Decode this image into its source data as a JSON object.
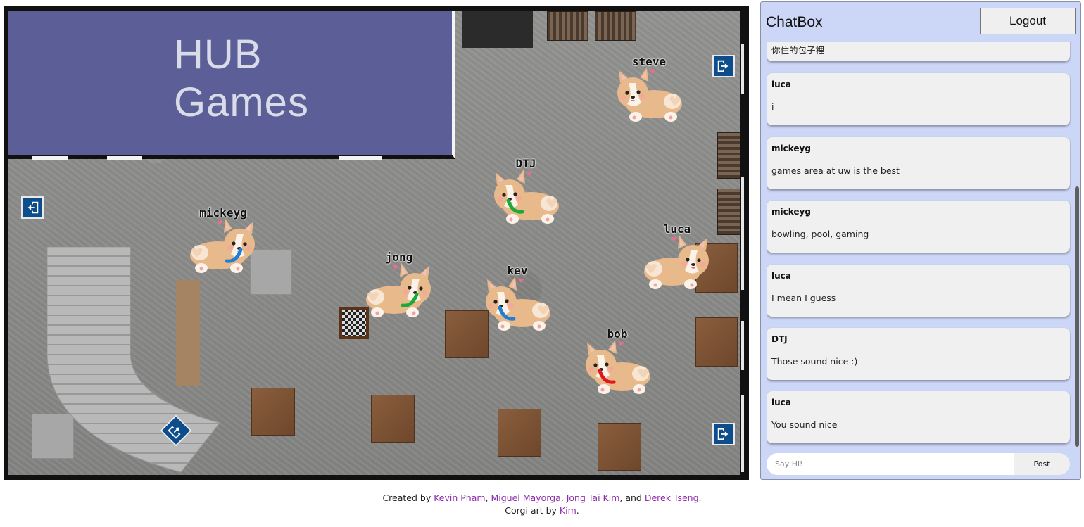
{
  "map": {
    "hub_title_line1": "HUB",
    "hub_title_line2": "Games",
    "players": [
      {
        "name": "steve",
        "collar": "none"
      },
      {
        "name": "DTJ",
        "collar": "green"
      },
      {
        "name": "mickeyg",
        "collar": "blue"
      },
      {
        "name": "luca",
        "collar": "none"
      },
      {
        "name": "jong",
        "collar": "green"
      },
      {
        "name": "kev",
        "collar": "blue"
      },
      {
        "name": "bob",
        "collar": "red"
      }
    ]
  },
  "chat": {
    "title": "ChatBox",
    "logout_label": "Logout",
    "partial_top_text": "你住的包子裡",
    "messages": [
      {
        "user": "luca",
        "text": "i"
      },
      {
        "user": "mickeyg",
        "text": "games area at uw is the best"
      },
      {
        "user": "mickeyg",
        "text": "bowling, pool, gaming"
      },
      {
        "user": "luca",
        "text": "I mean I guess"
      },
      {
        "user": "DTJ",
        "text": "Those sound nice :)"
      },
      {
        "user": "luca",
        "text": "You sound nice"
      }
    ],
    "input_placeholder": "Say Hi!",
    "post_label": "Post"
  },
  "footer": {
    "created_by": "Created by ",
    "author1": "Kevin Pham",
    "sep1": ", ",
    "author2": "Miguel Mayorga",
    "sep2": ", ",
    "author3": "Jong Tai Kim",
    "sep3": ", and ",
    "author4": "Derek Tseng",
    "end1": ".",
    "art_by": "Corgi art by ",
    "artist": "Kim",
    "end2": "."
  },
  "colors": {
    "collar_green": "#1fa93b",
    "collar_blue": "#1f7ed6",
    "collar_red": "#e2161f",
    "link": "#8f2aa9",
    "chat_bg": "#ccd6f6",
    "hub_bg": "#5c5f97"
  }
}
